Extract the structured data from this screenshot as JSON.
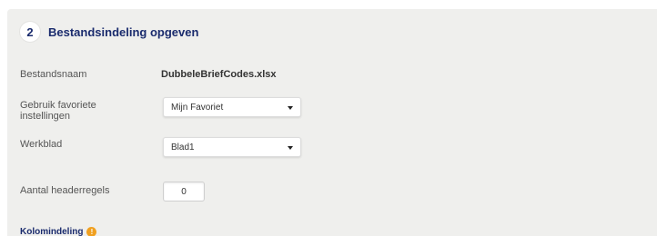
{
  "step": {
    "number": "2",
    "title": "Bestandsindeling opgeven"
  },
  "fields": {
    "filename": {
      "label": "Bestandsnaam",
      "value": "DubbeleBriefCodes.xlsx"
    },
    "favorites": {
      "label_line1": "Gebruik favoriete",
      "label_line2": "instellingen",
      "selected": "Mijn Favoriet"
    },
    "sheet": {
      "label": "Werkblad",
      "selected": "Blad1"
    },
    "header_rows": {
      "label": "Aantal headerregels",
      "value": "0"
    }
  },
  "column_section": {
    "title": "Kolomindeling",
    "icon": "info-icon",
    "icon_glyph": "!"
  },
  "colors": {
    "panel_bg": "#efefed",
    "heading": "#1a2b6d",
    "info_icon": "#f0a020"
  }
}
